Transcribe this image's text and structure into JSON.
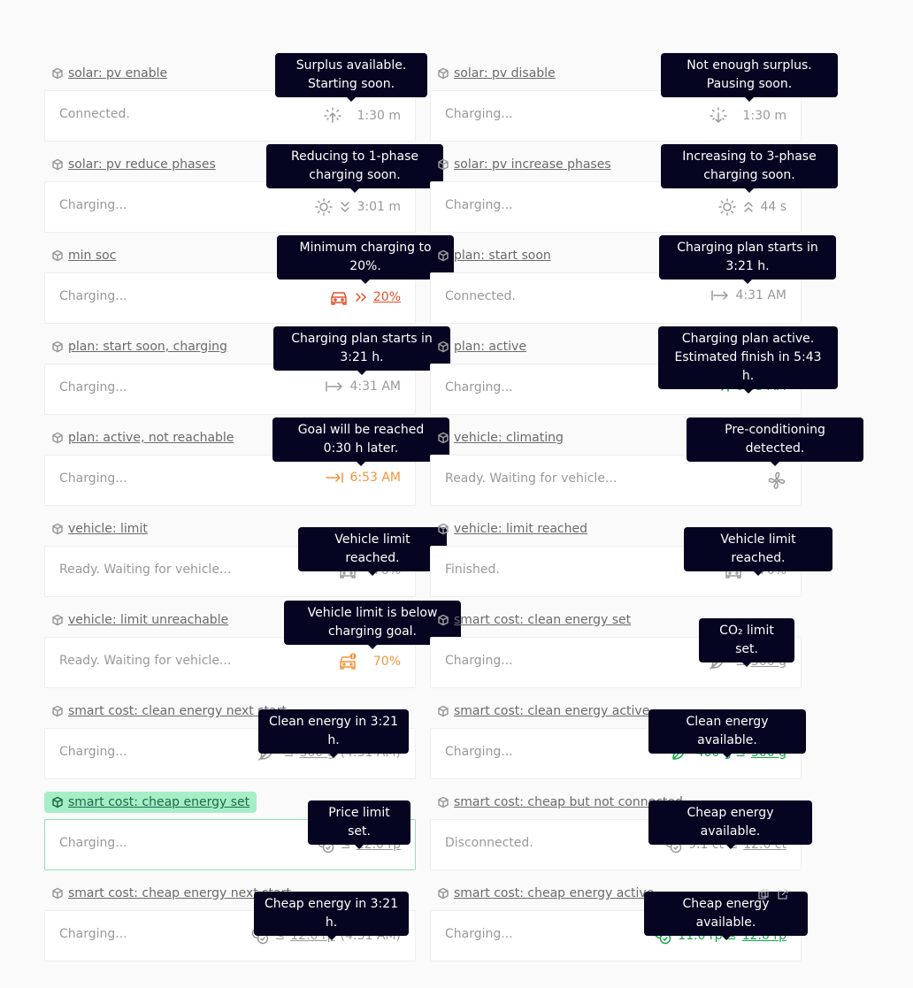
{
  "stories": [
    {
      "title": "solar: pv enable",
      "status": "Connected.",
      "value": "1:30 m",
      "tooltip": [
        "Surplus available.",
        "Starting soon."
      ]
    },
    {
      "title": "solar: pv disable",
      "status": "Charging...",
      "value": "1:30 m",
      "tooltip": [
        "Not enough surplus.",
        "Pausing soon."
      ]
    },
    {
      "title": "solar: pv reduce phases",
      "status": "Charging...",
      "value": "3:01 m",
      "tooltip": [
        "Reducing to 1-phase",
        "charging soon."
      ]
    },
    {
      "title": "solar: pv increase phases",
      "status": "Charging...",
      "value": "44 s",
      "tooltip": [
        "Increasing to 3-phase",
        "charging soon."
      ]
    },
    {
      "title": "min soc",
      "status": "Charging...",
      "value": "20%",
      "tooltip": [
        "Minimum charging to",
        "20%."
      ]
    },
    {
      "title": "plan: start soon",
      "status": "Connected.",
      "value": "4:31 AM",
      "tooltip": [
        "Charging plan starts in",
        "3:21 h."
      ]
    },
    {
      "title": "plan: start soon, charging",
      "status": "Charging...",
      "value": "4:31 AM",
      "tooltip": [
        "Charging plan starts in",
        "3:21 h."
      ]
    },
    {
      "title": "plan: active",
      "status": "Charging...",
      "value": "6:53 AM",
      "tooltip": [
        "Charging plan active.",
        "Estimated finish in 5:43 h."
      ]
    },
    {
      "title": "plan: active, not reachable",
      "status": "Charging...",
      "value": "6:53 AM",
      "tooltip": [
        "Goal will be reached",
        "0:30 h later."
      ]
    },
    {
      "title": "vehicle: climating",
      "status": "Ready. Waiting for vehicle...",
      "value": "",
      "tooltip": [
        "Pre-conditioning",
        "detected."
      ]
    },
    {
      "title": "vehicle: limit",
      "status": "Ready. Waiting for vehicle...",
      "value": "70%",
      "tooltip": [
        "Vehicle limit reached."
      ]
    },
    {
      "title": "vehicle: limit reached",
      "status": "Finished.",
      "value": "70%",
      "tooltip": [
        "Vehicle limit reached."
      ]
    },
    {
      "title": "vehicle: limit unreachable",
      "status": "Ready. Waiting for vehicle...",
      "value": "70%",
      "tooltip": [
        "Vehicle limit is below",
        "charging goal."
      ]
    },
    {
      "title": "smart cost: clean energy set",
      "status": "Charging...",
      "value_prefix": "≤",
      "value": "500 g",
      "tooltip": [
        "CO₂ limit set."
      ]
    },
    {
      "title": "smart cost: clean energy next start",
      "status": "Charging...",
      "value_prefix": "≤",
      "value": "500 g",
      "value_suffix": "(4:31 AM)",
      "tooltip": [
        "Clean energy in 3:21 h."
      ]
    },
    {
      "title": "smart cost: clean energy active",
      "status": "Charging...",
      "value_current": "400 g ≤",
      "value": "500 g",
      "tooltip": [
        "Clean energy available."
      ]
    },
    {
      "title": "smart cost: cheap energy set",
      "status": "Charging...",
      "value_prefix": "≤",
      "value": "12.0 rp",
      "tooltip": [
        "Price limit set."
      ]
    },
    {
      "title": "smart cost: cheap but not connected",
      "status": "Disconnected.",
      "value_current": "9.1 ct ≤",
      "value": "12.0 ct",
      "tooltip": [
        "Cheap energy available."
      ]
    },
    {
      "title": "smart cost: cheap energy next start",
      "status": "Charging...",
      "value_prefix": "≤",
      "value": "12.0 rp",
      "value_suffix": "(4:31 AM)",
      "tooltip": [
        "Cheap energy in 3:21 h."
      ]
    },
    {
      "title": "smart cost: cheap energy active",
      "status": "Charging...",
      "value_current": "11.0 rp ≤",
      "value": "12.0 rp",
      "tooltip": [
        "Cheap energy available."
      ]
    }
  ],
  "colors": {
    "tooltip_bg": "#050521",
    "green": "#17a34a",
    "orange": "#f29439",
    "red": "#e2502b",
    "selected_bg": "#a5eec8"
  }
}
